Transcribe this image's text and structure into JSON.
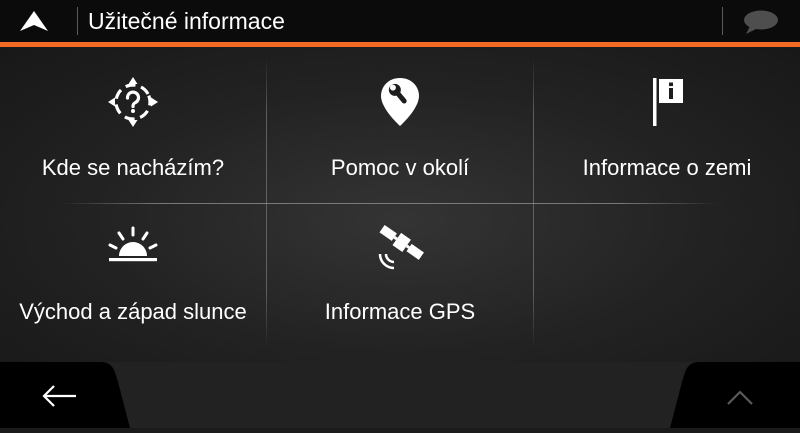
{
  "header": {
    "title": "Užitečné informace",
    "logo_icon": "navigation-arrow-icon",
    "message_icon": "chat-bubble-icon"
  },
  "colors": {
    "accent": "#f36a24",
    "header_bg": "#0b0b0b",
    "text": "#ffffff"
  },
  "tiles": [
    {
      "label": "Kde se nacházím?",
      "icon": "location-question-icon"
    },
    {
      "label": "Pomoc v okolí",
      "icon": "help-nearby-pin-icon"
    },
    {
      "label": "Informace o zemi",
      "icon": "country-flag-info-icon"
    },
    {
      "label": "Východ a západ slunce",
      "icon": "sunrise-icon"
    },
    {
      "label": "Informace GPS",
      "icon": "gps-satellite-icon"
    }
  ],
  "footer": {
    "back_icon": "back-arrow-icon",
    "up_icon": "chevron-up-icon"
  }
}
